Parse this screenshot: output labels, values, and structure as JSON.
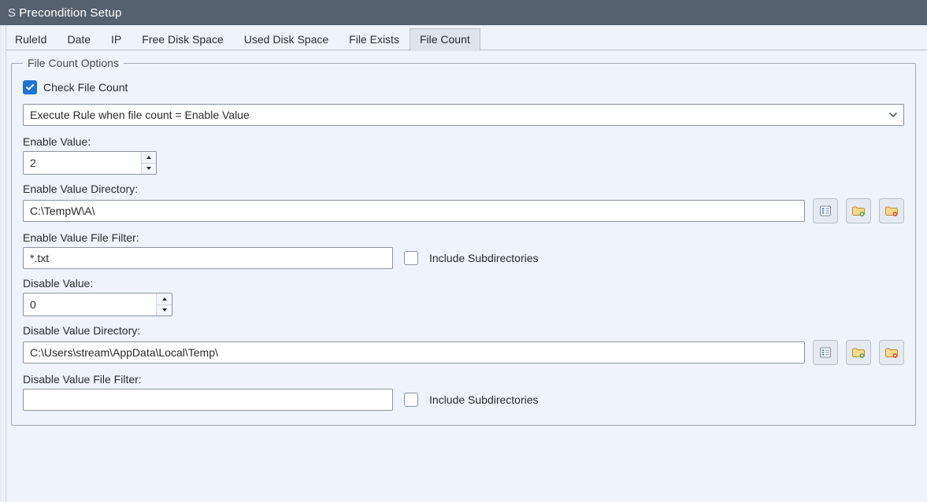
{
  "title": "Precondition Setup",
  "tabs": {
    "items": [
      "RuleId",
      "Date",
      "IP",
      "Free Disk Space",
      "Used Disk Space",
      "File Exists",
      "File Count"
    ],
    "activeIndex": 6
  },
  "group": {
    "legend": "File Count Options",
    "check": {
      "checked": true,
      "label": "Check File Count"
    },
    "ruleSelect": {
      "value": "Execute Rule when file count = Enable Value"
    },
    "enable": {
      "valueLabel": "Enable Value:",
      "value": "2",
      "dirLabel": "Enable Value Directory:",
      "dir": "C:\\TempW\\A\\",
      "filterLabel": "Enable Value File Filter:",
      "filter": "*.txt",
      "includeSubLabel": "Include Subdirectories",
      "includeSubChecked": false
    },
    "disable": {
      "valueLabel": "Disable Value:",
      "value": "0",
      "dirLabel": "Disable Value Directory:",
      "dir": "C:\\Users\\stream\\AppData\\Local\\Temp\\",
      "filterLabel": "Disable Value File Filter:",
      "filter": "",
      "includeSubLabel": "Include Subdirectories",
      "includeSubChecked": false
    }
  },
  "icons": {
    "browseList": "list-icon",
    "folderAdd": "folder-add-icon",
    "folderRemove": "folder-remove-icon"
  }
}
